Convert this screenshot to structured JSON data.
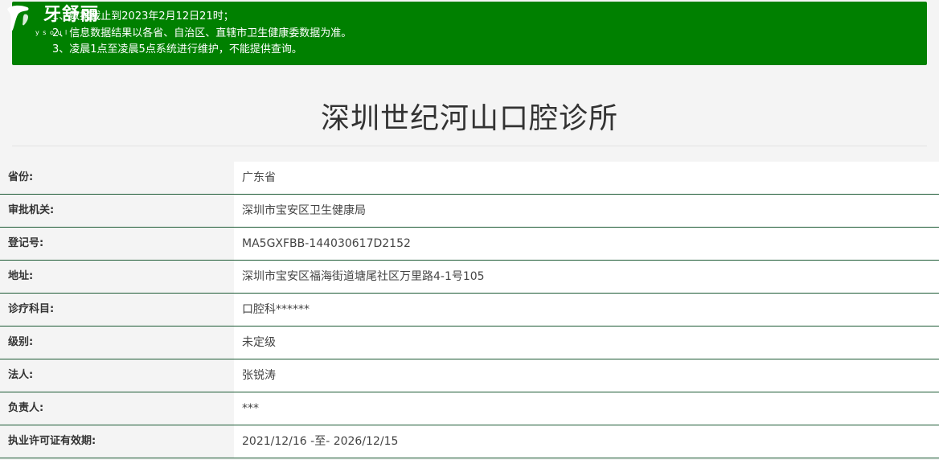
{
  "brand": {
    "name": "牙舒丽",
    "tagline": "y s o u l i"
  },
  "notice": {
    "lines": [
      "1、数据截止到2023年2月12日21时；",
      "2、信息数据结果以各省、自治区、直辖市卫生健康委数据为准。",
      "3、凌晨1点至凌晨5点系统进行维护，不能提供查询。"
    ],
    "background_color": "#008000"
  },
  "clinic": {
    "name": "深圳世纪河山口腔诊所"
  },
  "details": [
    {
      "label": "省份:",
      "value": "广东省"
    },
    {
      "label": "审批机关:",
      "value": "深圳市宝安区卫生健康局"
    },
    {
      "label": "登记号:",
      "value": "MA5GXFBB-144030617D2152"
    },
    {
      "label": "地址:",
      "value": "深圳市宝安区福海街道塘尾社区万里路4-1号105"
    },
    {
      "label": "诊疗科目:",
      "value": "口腔科******"
    },
    {
      "label": "级别:",
      "value": "未定级"
    },
    {
      "label": "法人:",
      "value": "张锐涛"
    },
    {
      "label": "负责人:",
      "value": "***"
    },
    {
      "label": "执业许可证有效期:",
      "value": "2021/12/16 -至- 2026/12/15"
    }
  ]
}
